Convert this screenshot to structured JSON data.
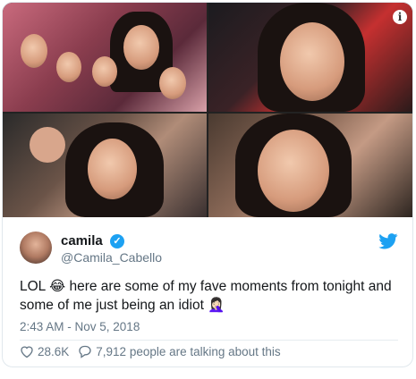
{
  "tweet": {
    "display_name": "camila",
    "handle": "@Camila_Cabello",
    "text_before_emoji": "LOL ",
    "emoji_laugh": "😂",
    "text_middle": " here are some of my fave moments from tonight and some of me just being an idiot ",
    "emoji_facepalm": "🤦🏻‍♀️",
    "timestamp": "2:43 AM - Nov 5, 2018",
    "likes": "28.6K",
    "conversation": "7,912 people are talking about this"
  },
  "colors": {
    "accent": "#1da1f2",
    "secondary_text": "#657786"
  },
  "icons": {
    "info": "info-icon",
    "verified": "verified-badge-icon",
    "brand": "twitter-bird-icon",
    "like": "heart-icon",
    "reply": "speech-bubble-icon"
  }
}
